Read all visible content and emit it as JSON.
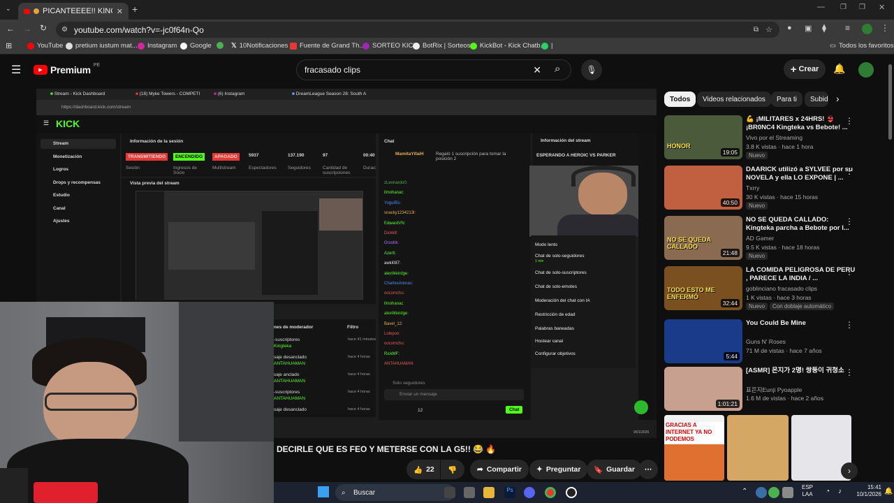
{
  "browser": {
    "tab_title": "PICANTEEEE!! KINGTEKA",
    "url": "youtube.com/watch?v=-jc0f64n-Qo",
    "bookmarks": [
      "YouTube",
      "pretium iustum mat...",
      "Instagram",
      "Google",
      "10Notificaciones",
      "Fuente de Grand Th...",
      "SORTEO KICK",
      "BotRix | Sorteos",
      "KickBot - Kick Chatb...",
      "|"
    ],
    "all_bookmarks": "Todos los favoritos"
  },
  "youtube": {
    "logo": "Premium",
    "region": "PE",
    "search_value": "fracasado clips",
    "create_label": "Crear",
    "video_caption": "DECIRLE QUE ES FEO Y METERSE CON LA G5!! 😂 🔥",
    "likes": "22",
    "share": "Compartir",
    "ask": "Preguntar",
    "save": "Guardar"
  },
  "kick": {
    "tabs": [
      "Stream - Kick Dashboard",
      "(18) Myke Towers - COMPETI",
      "(6) Instagram",
      "DreamLeague Season 28: South A"
    ],
    "url": "https://dashboard.kick.com/stream",
    "nav": [
      "Stream",
      "Monetización",
      "Logros",
      "Drops y recompensas",
      "Estudio",
      "Canal",
      "Ajustes"
    ],
    "session_title": "Información de la sesión",
    "badges": [
      "TRANSMITIENDO",
      "ENCENDIDO",
      "APAGADO"
    ],
    "stats": [
      {
        "v": "5937",
        "l": "Espectadores"
      },
      {
        "v": "137.190",
        "l": "Seguidores"
      },
      {
        "v": "97",
        "l": "Cantidad de suscripciones"
      },
      {
        "v": "00:40",
        "l": "Duración en vivo"
      }
    ],
    "labels": [
      "Sesión",
      "Ingresos de Socio",
      "Multistream"
    ],
    "preview_title": "Vista previa del stream",
    "chat_title": "Chat",
    "gift_user": "MamitaYifaiH",
    "gift_text": "Regaló 1 suscripción para tomar la posición 2",
    "chat_users": [
      "zLeonardo0:",
      "llmohanac",
      "Yoguil5s:",
      "snacky1234213l:",
      "EdwardVN:",
      "Dickk8:",
      "Grushk:",
      "Azerti:",
      "awki087:",
      "alexWeirdge:",
      "CharlesArenas:",
      "oocomchu:",
      "llmohanac",
      "alexWeirdge:",
      "Bavel_12:",
      "Lolepoo:",
      "oocomchu:",
      "RickMF:",
      "ANTAHUAMAN"
    ],
    "chat_mode": "Solo seguidores",
    "send_placeholder": "Enviar un mensaje",
    "chat_count": "12",
    "chat_button": "Chat",
    "stream_info_title": "Información del stream",
    "waiting_text": "ESPERANDO A HEROIC VS PARKER",
    "mod_title": "nes de moderador",
    "mod_filter": "Filtro",
    "mod_log": [
      {
        "a": "-suscriptores",
        "b": "Kingteka",
        "t": "hace 41 minutos"
      },
      {
        "a": "saje desanclado",
        "b": "ANTAHUAMAN",
        "t": "hace 4 horas"
      },
      {
        "a": "saje anclado",
        "b": "ANTAHUAMAN",
        "t": "hace 4 horas"
      },
      {
        "a": "-suscriptores",
        "b": "ANTAHUAMAN",
        "t": "hace 4 horas"
      },
      {
        "a": "saje desanclado",
        "b": "",
        "t": "hace 4 horas"
      }
    ],
    "chat_settings": [
      "Modo lento",
      "Chat de solo-seguidores",
      "Chat de solo-suscriptores",
      "Chat de solo-emotes",
      "Moderación del chat con IA",
      "Restricción de edad",
      "Palabras baneadas",
      "Hostear canal",
      "Configurar objetivos"
    ],
    "slow_note": "1 min",
    "clock_small": "9/01/2026"
  },
  "sidebar": {
    "chips": [
      "Todos",
      "Videos relacionados",
      "Para ti",
      "Subid"
    ],
    "videos": [
      {
        "title": "💪 ¡MILITARES x 24HRS! 👙 ¡BR0NC4 Kingteka vs Bebote! ...",
        "channel": "Vivo por el Streaming",
        "meta": "3.8 K vistas · hace 1 hora",
        "dur": "19:05",
        "badge": "Nuevo",
        "thumb_text": "HONOR",
        "color": "#4a5a3a"
      },
      {
        "title": "DAARICK utilizó a SYLVEE por su NOVELA y ella LO EXPONE | ...",
        "channel": "Txrry",
        "meta": "30 K vistas · hace 15 horas",
        "dur": "40:50",
        "badge": "Nuevo",
        "thumb_text": "",
        "color": "#c06040"
      },
      {
        "title": "NO SE QUEDA CALLADO: Kingteka parcha a Bebote por l...",
        "channel": "AD Gamer",
        "meta": "9.5 K vistas · hace 18 horas",
        "dur": "21:48",
        "badge": "Nuevo",
        "thumb_text": "NO SE QUEDA CALLADO",
        "color": "#8a6a50"
      },
      {
        "title": "LA COMIDA PELIGROSA DE PERU , PARECE LA INDIA / ...",
        "channel": "goblinciano fracasado clips",
        "meta": "1 K vistas · hace 3 horas",
        "dur": "32:44",
        "badge": "Nuevo",
        "badge2": "Con doblaje automático",
        "thumb_text": "TODO ESTO ME ENFERMÓ",
        "color": "#7a5020"
      },
      {
        "title": "You Could Be Mine",
        "channel": "Guns N' Roses",
        "meta": "71 M de vistas · hace 7 años",
        "dur": "5:44",
        "thumb_text": "",
        "color": "#1a3a8a"
      },
      {
        "title": "[ASMR] 은지가 2명! 쌍둥이 귀청소",
        "channel": "표은지Eunji Pyoapple",
        "meta": "1.6 M de vistas · hace 2 años",
        "dur": "1:01:21",
        "thumb_text": "",
        "color": "#c8a090"
      }
    ],
    "shorts_text": "GRACIAS A INTERNET YA NO PODEMOS"
  },
  "taskbar": {
    "search": "Buscar",
    "lang1": "ESP",
    "lang2": "LAA",
    "time": "15:41",
    "date": "10/1/2026"
  }
}
